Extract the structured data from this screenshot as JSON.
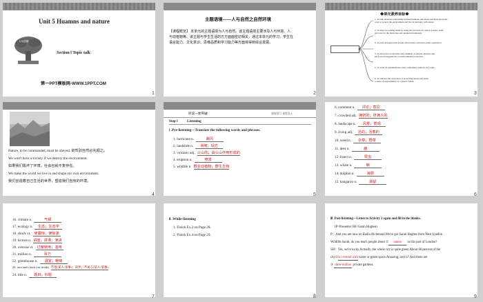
{
  "slides": {
    "s1": {
      "page": "1",
      "title": "Unit 5    Huamns and nature",
      "tree_label": "人与自然",
      "section": "Section Ⅰ  Topic talk",
      "brand": "第一PPT模板网-WWW.1PPT.COM"
    },
    "s2": {
      "page": "2",
      "heading": "主题语境——人与自然之自然环境",
      "para": [
        "【课程概览】 本单元的主题语境为人与自然。该主题语境主要涉及人与环境、人",
        "与动植物等。该主题与学生生活的方方面面密切相关，通过本单元的学习，学生在",
        "语言能力、文化意识、思维品质和学习能力等方面将得到综合发展。"
      ]
    },
    "s3": {
      "page": "3",
      "header": "◆单元素养目标◆",
      "targets": [
        "1. To talk about the relationship between humans and nature and learn about the",
        "   ways to protect the environment and live in harmony with nature.",
        "2. To improve reading skills by using the structure of a text to predict, skim",
        "   and scan for the main idea and detailed information.",
        "3. To read and appreciate poems about nature and learn poetic expression.",
        "4. To know how to describe and comment on natural disasters and",
        "   put forward suggestions on environmental protection.",
        "5. To write an argumentative essay expressing opinions on a topic.",
        "6. To enhance the awareness of protecting nature and build",
        "   a sense of responsibility as a global citizen."
      ]
    },
    "s4": {
      "page": "4",
      "lines": [
        "Nature, to be commanded, must be obeyed. 欲驾驭自然必先顺之。",
        "We won't have a society if we destroy the environment.",
        "如果我们毁坏了环境，社会也就不复存在。",
        "We make the world we live in and shape our own environment.",
        "我们创造着自己生活的世界，塑造我们自身的环境。"
      ]
    },
    "s5": {
      "page": "5",
      "tab": "听说一体突破",
      "tab_right": "课前预习  课堂导入",
      "step": "Step Ⅰ",
      "step_title": "Listening",
      "pre_title": "Ⅰ .Pre-listening—Translate the following words and phrases.",
      "words": [
        {
          "n": "1.",
          "w": "hurricane n.",
          "a": "飓风"
        },
        {
          "n": "2.",
          "w": "landslide n.",
          "a": "滑坡；塌方"
        },
        {
          "n": "3.",
          "w": "volcanic adj.",
          "a": "火山的；由火山作用形成的"
        },
        {
          "n": "4.",
          "w": "eruption n.",
          "a": "喷发"
        },
        {
          "n": "5.",
          "w": "wildlife n.",
          "a": "野生动植物；野生生物"
        }
      ]
    },
    "s6": {
      "page": "6",
      "words": [
        {
          "n": "6.",
          "w": "comment n.",
          "a": "评论；意见"
        },
        {
          "n": "7.",
          "w": "crowded adj.",
          "a": "拥挤的；挤满人的"
        },
        {
          "n": "8.",
          "w": "landscape n.",
          "a": "风景；景观"
        },
        {
          "n": "9.",
          "w": "living adj.",
          "a": "活的；活着的"
        },
        {
          "n": "10.",
          "w": "weed n.",
          "a": "杂草；野草"
        },
        {
          "n": "11.",
          "w": "deer n.",
          "a": "鹿"
        },
        {
          "n": "12.",
          "w": "insect n.",
          "a": "昆虫"
        },
        {
          "n": "13.",
          "w": "whale n.",
          "a": "鲸"
        },
        {
          "n": "14.",
          "w": "dolphin n.",
          "a": "海豚"
        },
        {
          "n": "15.",
          "w": "kangaroo n.",
          "a": "袋鼠"
        }
      ]
    },
    "s7": {
      "page": "7",
      "words": [
        {
          "n": "16.",
          "w": "climate n.",
          "a": "气候"
        },
        {
          "n": "17.",
          "w": "ecology n.",
          "a": "生态；生态学"
        },
        {
          "n": "18.",
          "w": "shock vt.",
          "a": "使震惊；使惊骇"
        },
        {
          "n": "19.",
          "w": "lecture n.",
          "a": "讲座；讲课；演讲"
        },
        {
          "n": "20.",
          "w": "overuse vt.",
          "a": "过度使用；滥用"
        },
        {
          "n": "21.",
          "w": "million n.",
          "a": "百万"
        },
        {
          "n": "22.",
          "w": "greenhouse n.",
          "a": "温室；暖房"
        },
        {
          "n": "23.",
          "w": "turn one's back (on sb/sth)",
          "a": "不理(某人/某事)；背弃；不关心(某人/某事)"
        },
        {
          "n": "24.",
          "w": "title n.",
          "a": "题目；标题"
        }
      ]
    },
    "s8": {
      "page": "8",
      "title": "Ⅱ .While-listening",
      "items": [
        "1.  Finish Ex.2 on Page 28.",
        "2.  Finish Ex.4 on Page 29."
      ]
    },
    "s9": {
      "page": "9",
      "title": "Ⅲ .Post-listening—Listen to Activity 2 again and fill in the blanks.",
      "roles": "(P=Presenter    SH=Sarah Hughes)",
      "p1": "P：And you are now on Radio Richmond.We've got Sarah Hughes from West London",
      "p2_a": "Wildlife.Sarah, do you teach people about ①",
      "blank1": "nature",
      "p2_b": " in this part of London?",
      "p3": "SH：Yes, we're lucky.Actually, the whole city is quite green.About 66 percent of the",
      "p4_a": "city②",
      "blank2": "is covered with",
      "p4_b": " water or green space.Amazing, isn't it? And there are",
      "p5_a": "③ ",
      "blank3": "three million",
      "p5_b": " private gardens."
    }
  }
}
